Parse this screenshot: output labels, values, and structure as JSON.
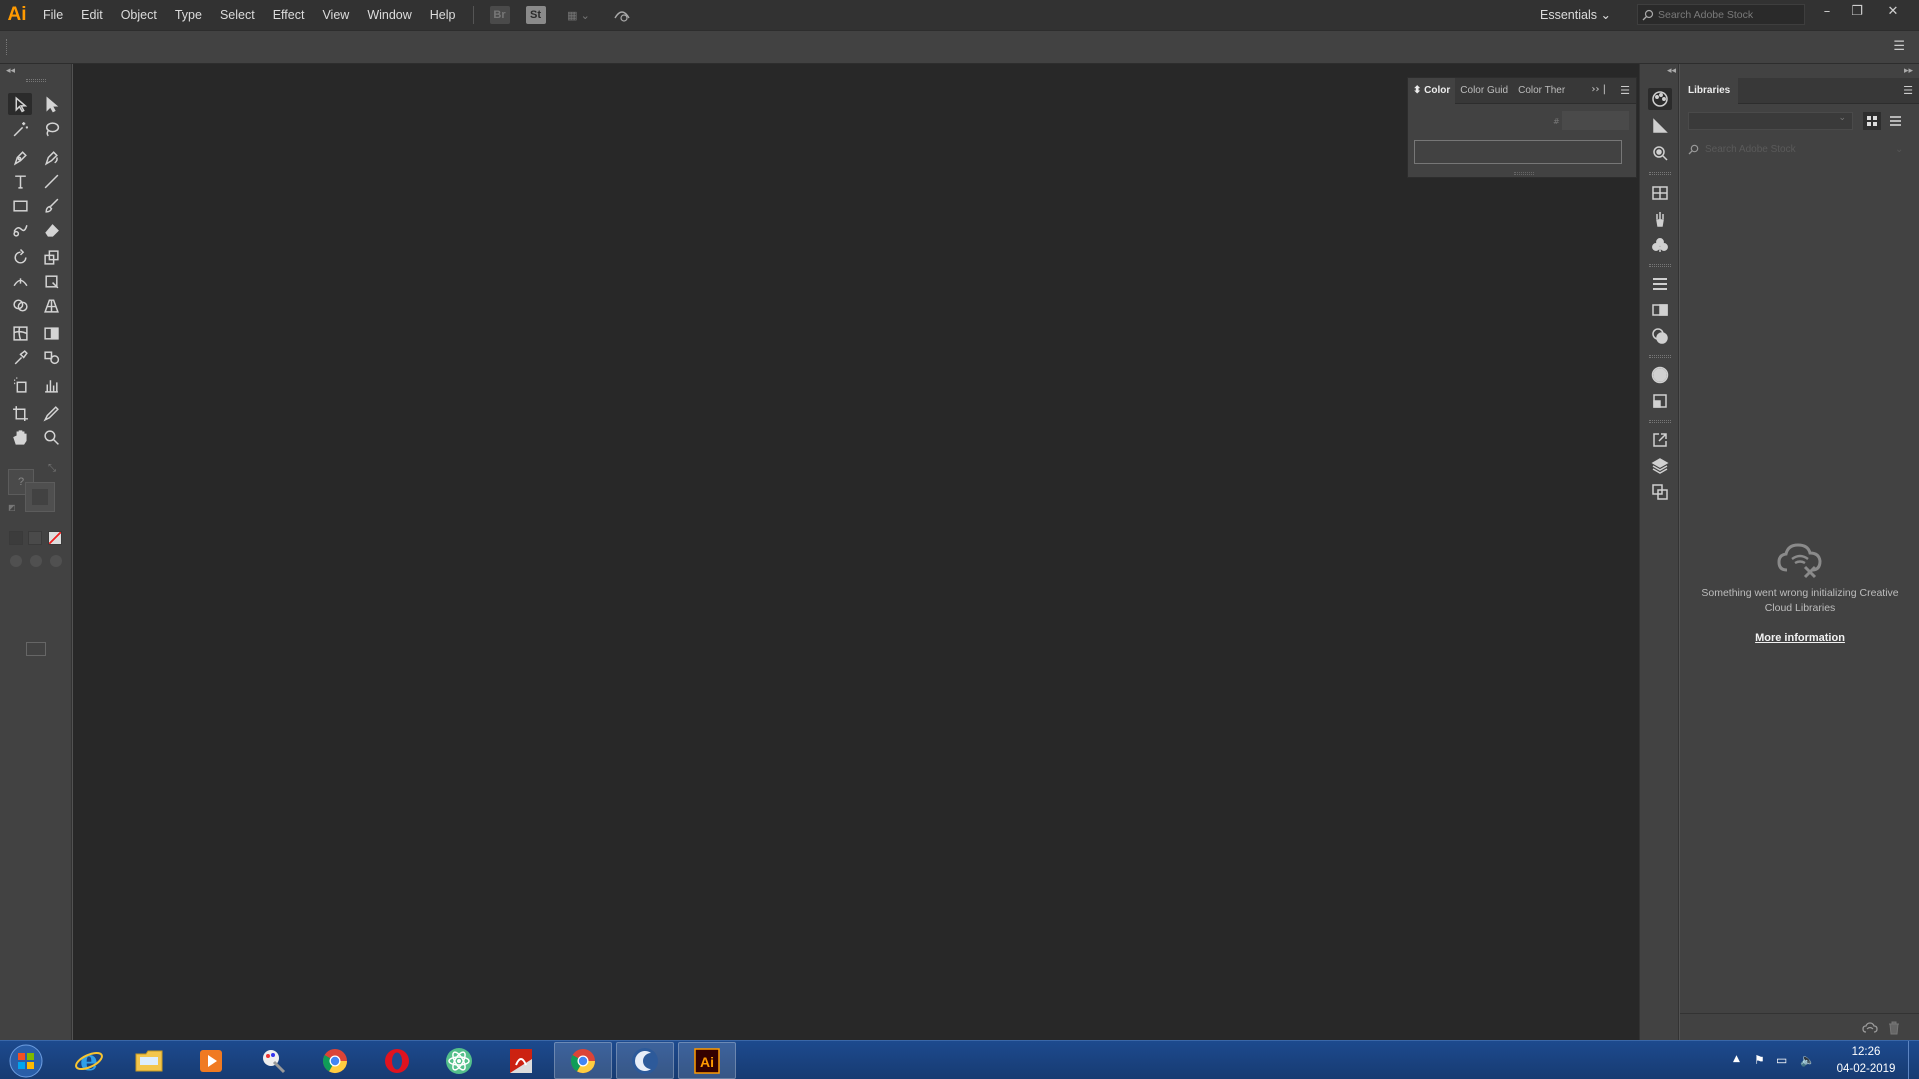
{
  "app": {
    "logo": "Ai"
  },
  "menu": [
    "File",
    "Edit",
    "Object",
    "Type",
    "Select",
    "Effect",
    "View",
    "Window",
    "Help"
  ],
  "menubar_icons": {
    "bridge": "Br",
    "stock": "St"
  },
  "workspace": {
    "label": "Essentials"
  },
  "stock_search": {
    "placeholder": "Search Adobe Stock"
  },
  "color_panel": {
    "tabs": [
      "Color",
      "Color Guid",
      "Color Ther"
    ],
    "hex_prefix": "#",
    "hex_value": ""
  },
  "libraries": {
    "title": "Libraries",
    "search_placeholder": "Search Adobe Stock",
    "error_message": "Something went wrong initializing Creative Cloud Libraries",
    "more_info_label": "More information"
  },
  "fill_stroke": {
    "fill_label": "?"
  },
  "taskbar": {
    "apps": [
      "internet-explorer",
      "file-explorer",
      "media-player",
      "paint-tool",
      "chrome",
      "opera",
      "atom",
      "acrobat",
      "chrome-open",
      "app-crescent",
      "illustrator"
    ],
    "clock_time": "12:26",
    "clock_date": "04-02-2019"
  },
  "colors": {
    "accent": "#ff9a00",
    "canvas": "#282828",
    "panel": "#424242",
    "taskbar": "#1d4a8e"
  }
}
